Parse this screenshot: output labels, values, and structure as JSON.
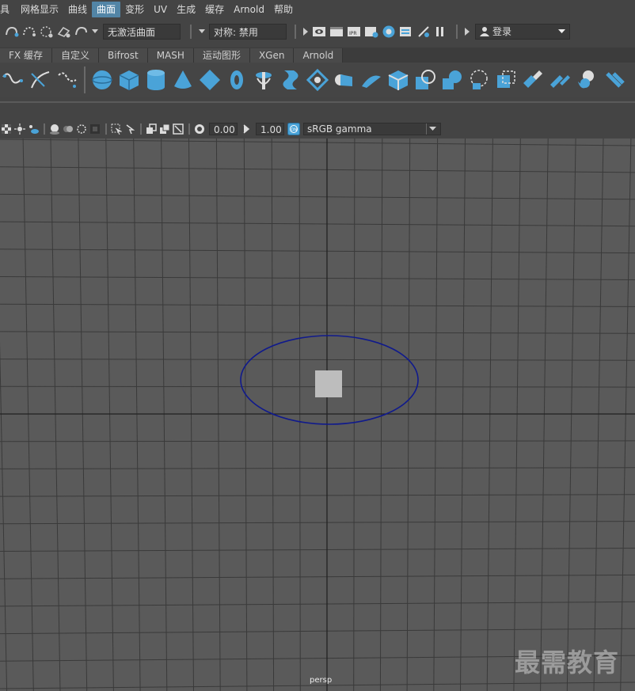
{
  "menu": {
    "items": [
      "具",
      "网格显示",
      "曲线",
      "曲面",
      "变形",
      "UV",
      "生成",
      "缓存",
      "Arnold",
      "帮助"
    ],
    "active_index": 3
  },
  "status": {
    "active_surface_field": "无激活曲面",
    "symmetry_field": "对称: 禁用",
    "login_label": "登录"
  },
  "shelf_tabs": [
    "FX 缓存",
    "自定义",
    "Bifrost",
    "MASH",
    "运动图形",
    "XGen",
    "Arnold"
  ],
  "panel_toolbar": {
    "exposure_value": "0.00",
    "gamma_value": "1.00",
    "colorspace_label": "sRGB gamma"
  },
  "viewport": {
    "camera_label": "persp",
    "curve_color": "#101a8c",
    "object_color": "#bdbdbd"
  },
  "watermark": "最需教育",
  "colors": {
    "accent": "#5285a6",
    "shelf_icon": "#4aa3d8",
    "viewport_bg": "#5a5a5a",
    "grid": "#3a3a3a"
  }
}
